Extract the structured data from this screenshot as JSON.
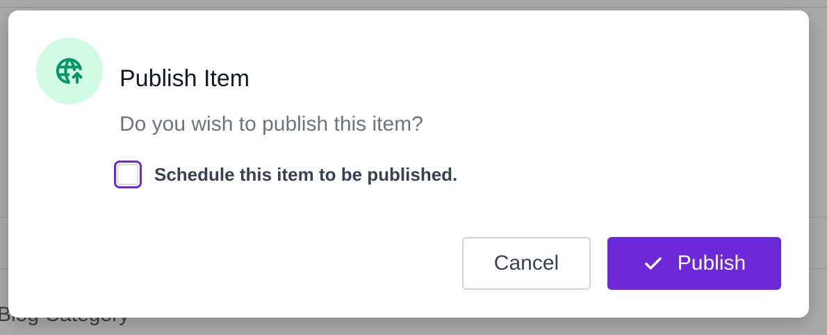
{
  "background": {
    "texts": [
      "Blog Category"
    ]
  },
  "modal": {
    "icon": "globe-upload-icon",
    "title": "Publish Item",
    "message": "Do you wish to publish this item?",
    "schedule_checkbox": {
      "label": "Schedule this item to be published.",
      "checked": false
    },
    "buttons": {
      "cancel_label": "Cancel",
      "publish_label": "Publish",
      "publish_icon": "check-icon"
    }
  },
  "colors": {
    "accent": "#6d28d9",
    "icon_bg": "#d1fae5",
    "icon_fg": "#059669",
    "overlay": "#a9a9a9"
  }
}
